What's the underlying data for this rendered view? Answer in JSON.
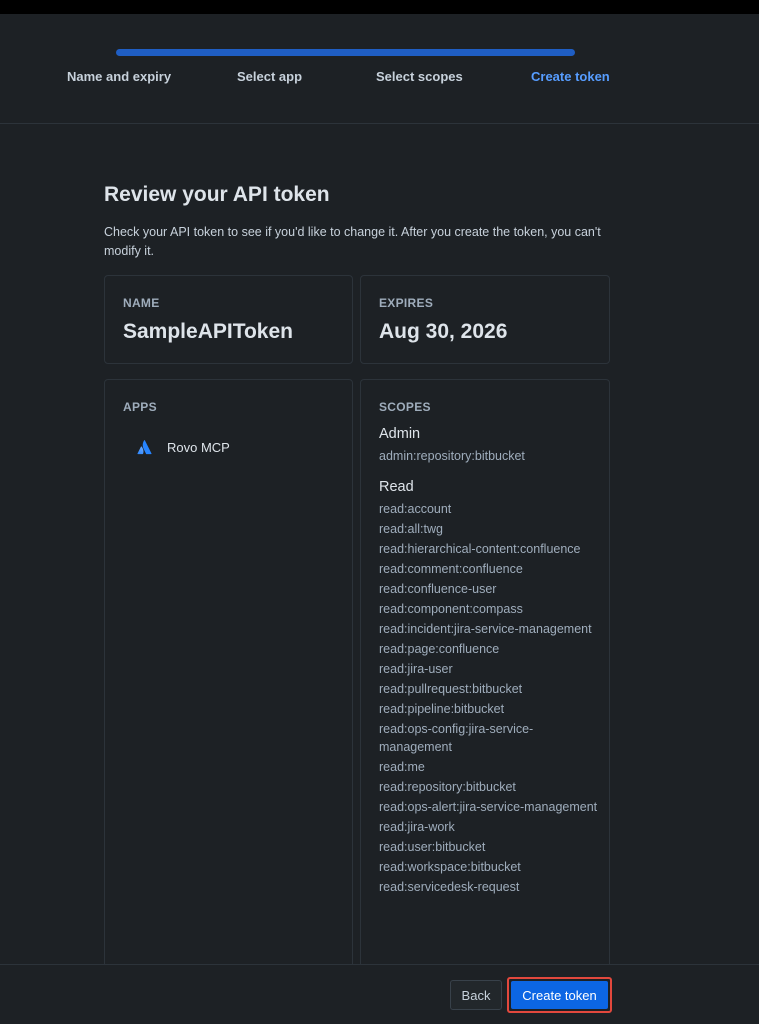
{
  "stepper": {
    "steps": [
      {
        "label": "Name and expiry",
        "active": false
      },
      {
        "label": "Select app",
        "active": false
      },
      {
        "label": "Select scopes",
        "active": false
      },
      {
        "label": "Create token",
        "active": true
      }
    ],
    "progress": 1.0
  },
  "page": {
    "title": "Review your API token",
    "description": "Check your API token to see if you'd like to change it. After you create the token, you can't modify it."
  },
  "name_card": {
    "label": "NAME",
    "value": "SampleAPIToken"
  },
  "expires_card": {
    "label": "EXPIRES",
    "value": "Aug 30, 2026"
  },
  "apps_card": {
    "label": "APPS",
    "items": [
      {
        "label": "Rovo MCP",
        "icon": "atlassian-logo-icon"
      }
    ]
  },
  "scopes_card": {
    "label": "SCOPES",
    "groups": [
      {
        "title": "Admin",
        "items": [
          "admin:repository:bitbucket"
        ]
      },
      {
        "title": "Read",
        "items": [
          "read:account",
          "read:all:twg",
          "read:hierarchical-content:confluence",
          "read:comment:confluence",
          "read:confluence-user",
          "read:component:compass",
          "read:incident:jira-service-management",
          "read:page:confluence",
          "read:jira-user",
          "read:pullrequest:bitbucket",
          "read:pipeline:bitbucket",
          "read:ops-config:jira-service-management",
          "read:me",
          "read:repository:bitbucket",
          "read:ops-alert:jira-service-management",
          "read:jira-work",
          "read:user:bitbucket",
          "read:workspace:bitbucket",
          "read:servicedesk-request"
        ]
      }
    ]
  },
  "footer": {
    "back_label": "Back",
    "create_label": "Create token"
  },
  "colors": {
    "background": "#1d2125",
    "accent": "#579dff",
    "primary_button": "#0c66e4",
    "highlight_border": "#e2483d"
  }
}
